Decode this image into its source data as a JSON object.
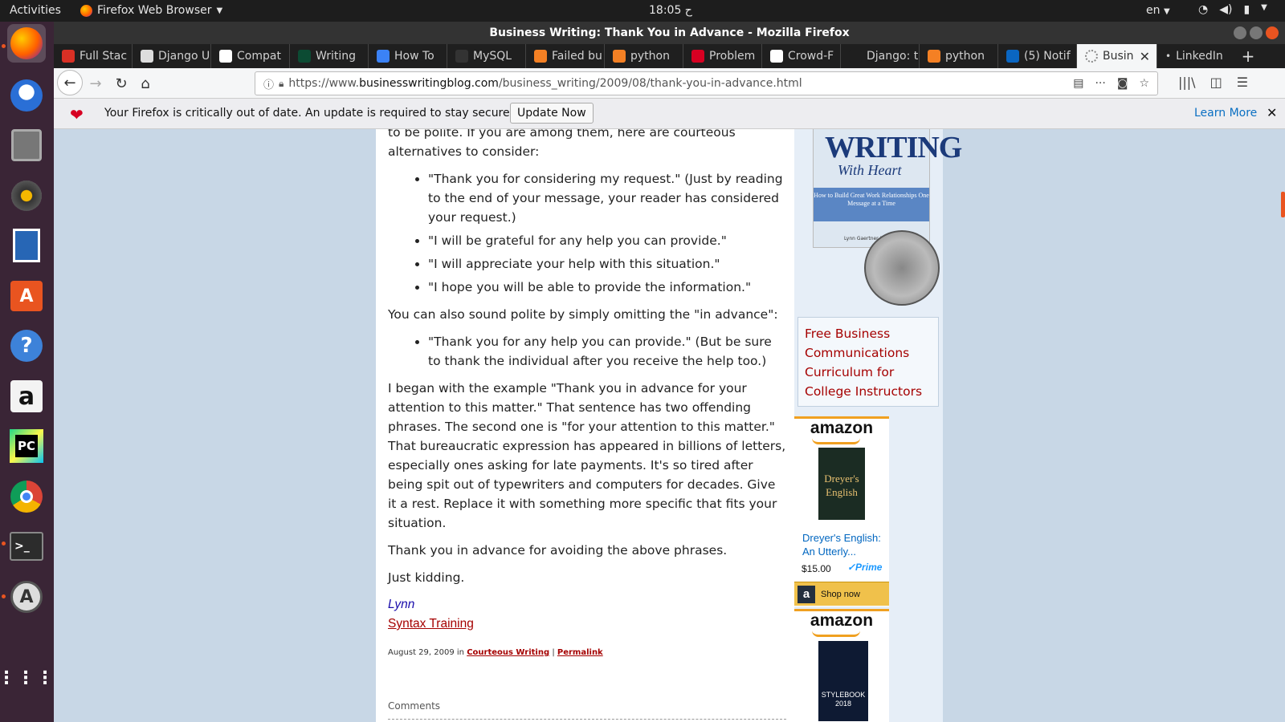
{
  "topbar": {
    "activities": "Activities",
    "app_menu": "Firefox Web Browser",
    "clock": "18:05 ح",
    "lang": "en"
  },
  "window": {
    "title": "Business Writing: Thank You in Advance - Mozilla Firefox"
  },
  "tabs": [
    {
      "label": "Full Stac",
      "icon_color": "#d93025"
    },
    {
      "label": "Django U",
      "icon_color": "#dddddd"
    },
    {
      "label": "Compat",
      "icon_color": "#ffffff"
    },
    {
      "label": "Writing",
      "icon_color": "#0c4b33"
    },
    {
      "label": "How To",
      "icon_color": "#3b82f6"
    },
    {
      "label": "MySQL",
      "icon_color": "#333333"
    },
    {
      "label": "Failed bu",
      "icon_color": "#f48024"
    },
    {
      "label": "python",
      "icon_color": "#f48024"
    },
    {
      "label": "Problem",
      "icon_color": "#d70022"
    },
    {
      "label": "Crowd-F",
      "icon_color": "#ffffff"
    },
    {
      "label": "Django: the",
      "icon_color": "#1f1f1f"
    },
    {
      "label": "python",
      "icon_color": "#f48024"
    },
    {
      "label": "(5) Notif",
      "icon_color": "#0a66c2"
    }
  ],
  "active_tab": {
    "label": "Busin",
    "close": "✕"
  },
  "last_tab": {
    "label": "LinkedIn"
  },
  "new_tab": "+",
  "url": {
    "prefix": "https://www.",
    "domain": "businesswritingblog.com",
    "path": "/business_writing/2009/08/thank-you-in-advance.html"
  },
  "notification": {
    "message": "Your Firefox is critically out of date. An update is required to stay secure.",
    "update_button": "Update Now",
    "learn_more": "Learn More"
  },
  "article": {
    "intro": "to be polite. If you are among them, here are courteous alternatives to consider:",
    "list1": [
      "\"Thank you for considering my request.\" (Just by reading to the end of your message, your reader has considered your request.)",
      "\"I will be grateful for any help you can provide.\"",
      "\"I will appreciate your help with this situation.\"",
      "\"I hope you will be able to provide the information.\""
    ],
    "p2": "You can also sound polite by simply omitting the \"in advance\":",
    "list2": [
      "\"Thank you for any help you can provide.\" (But be sure to thank the individual after you receive the help too.)"
    ],
    "p3": "I began with the example \"Thank you in advance for your attention to this matter.\" That sentence has two offending phrases. The second one is \"for your attention to this matter.\" That bureaucratic expression has appeared in billions of letters, especially ones asking for late payments. It's so tired after being spit out of typewriters and computers for decades. Give it a rest. Replace it with something more specific that fits your situation.",
    "p4": "Thank you in advance for avoiding the above phrases.",
    "p5": "Just kidding.",
    "signature": "Lynn",
    "company": "Syntax Training",
    "meta_date": "August 29, 2009 in ",
    "meta_category": "Courteous Writing",
    "meta_sep": " | ",
    "meta_permalink": "Permalink",
    "comments_label": "Comments"
  },
  "sidebar": {
    "book": {
      "title1": "WRITING",
      "title2": "With Heart",
      "subtitle": "How to Build Great Work Relationships One Message at a Time",
      "author": "Lynn Gaertner-Johnston"
    },
    "free_link": "Free Business Communications Curriculum for College Instructors",
    "ad1": {
      "brand": "amazon",
      "cover": "Dreyer's English",
      "title": "Dreyer's English: An Utterly...",
      "price": "$15.00",
      "prime": "✓Prime",
      "shop": "Shop now"
    },
    "ad2": {
      "brand": "amazon",
      "cover": "STYLEBOOK 2018"
    }
  }
}
